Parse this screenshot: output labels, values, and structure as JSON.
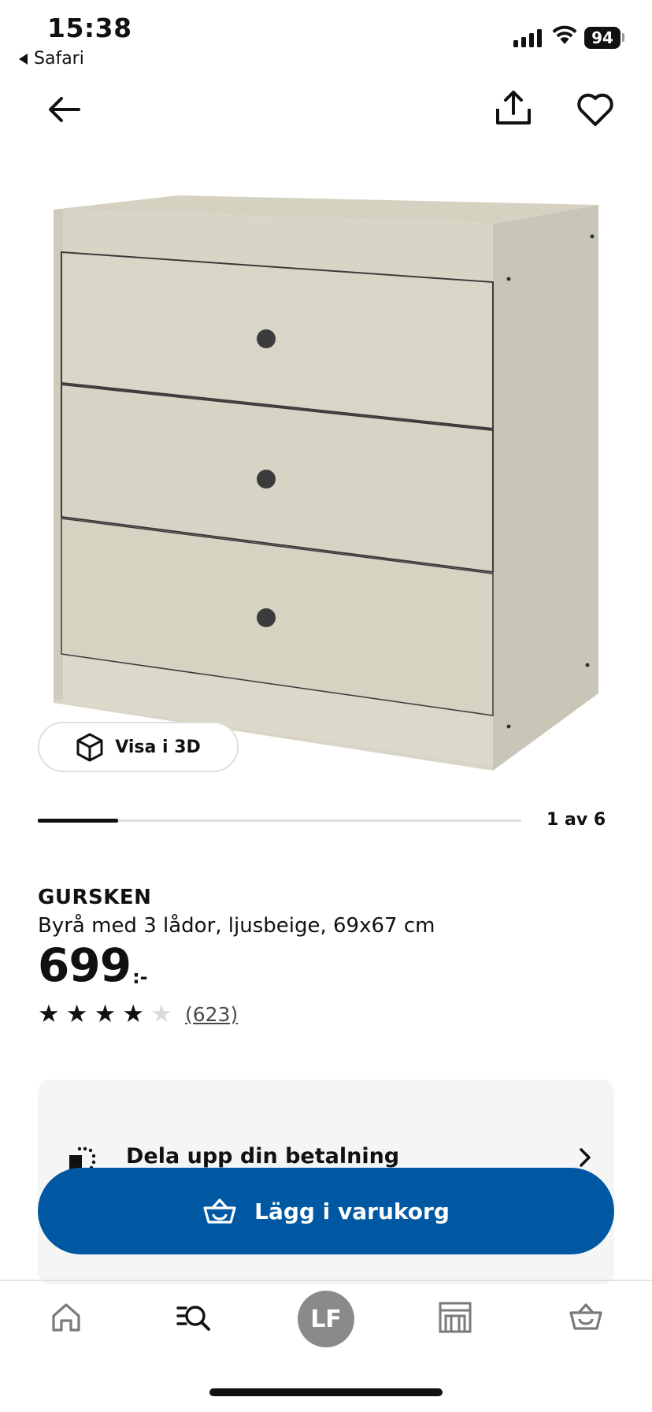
{
  "status_bar": {
    "time": "15:38",
    "back_app": "Safari",
    "battery": "94"
  },
  "gallery": {
    "view_3d_label": "Visa i 3D",
    "page_indicator": "1 av 6",
    "current_image": 1,
    "total_images": 6
  },
  "product": {
    "name": "GURSKEN",
    "description": "Byrå med 3 lådor, ljusbeige, 69x67 cm",
    "price": "699",
    "price_suffix": ":-",
    "rating": 4,
    "rating_max": 5,
    "review_count": "(623)"
  },
  "payment": {
    "label": "Dela upp din betalning"
  },
  "cart": {
    "add_label": "Lägg i varukorg"
  },
  "bottom_nav": {
    "avatar_initials": "LF",
    "items": [
      "home-icon",
      "search-icon",
      "avatar",
      "store-icon",
      "cart-icon"
    ]
  },
  "colors": {
    "primary_blue": "#0058a3",
    "product_beige": "#d9d5c5",
    "card_bg": "#f5f5f5"
  }
}
